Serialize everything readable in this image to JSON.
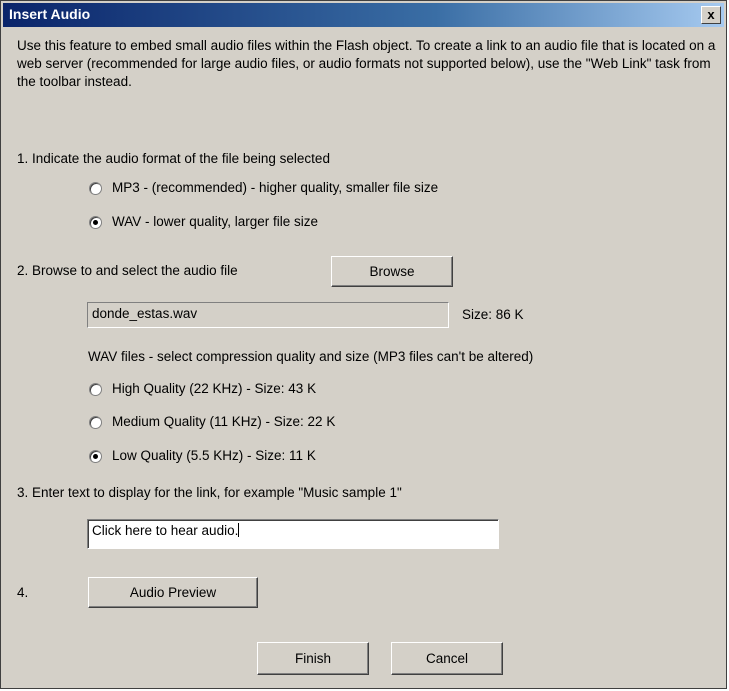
{
  "window": {
    "title": "Insert Audio",
    "close_label": "x"
  },
  "intro": "Use this feature to embed small audio files within the Flash object.  To create a link to an audio file that is located on a web server (recommended for large audio files, or audio formats not supported below), use the \"Web Link\" task from the toolbar instead.",
  "step1": {
    "label": "1.  Indicate the audio format of the file being selected",
    "options": [
      {
        "label": "MP3 - (recommended) - higher quality, smaller file size",
        "selected": false
      },
      {
        "label": "WAV - lower quality, larger file size",
        "selected": true
      }
    ]
  },
  "step2": {
    "label": "2.  Browse to and select the audio file",
    "browse_label": "Browse",
    "file_value": "donde_estas.wav",
    "size_label": "Size: 86 K",
    "compression_label": "WAV files - select compression quality and size   (MP3 files can't be altered)",
    "qualities": [
      {
        "label": "High Quality (22 KHz) - Size: 43 K",
        "selected": false
      },
      {
        "label": "Medium Quality (11 KHz) - Size: 22 K",
        "selected": false
      },
      {
        "label": "Low Quality (5.5 KHz) - Size: 11 K",
        "selected": true
      }
    ]
  },
  "step3": {
    "label": "3.  Enter text to display for the link, for example \"Music sample 1\"",
    "link_text": "Click here to hear audio."
  },
  "step4": {
    "label": "4.",
    "preview_label": "Audio Preview"
  },
  "footer": {
    "finish_label": "Finish",
    "cancel_label": "Cancel"
  }
}
